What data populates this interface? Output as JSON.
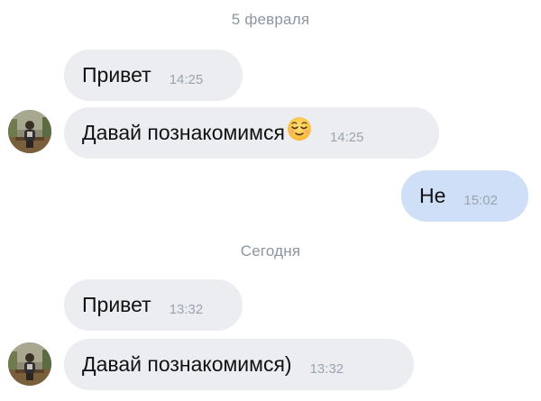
{
  "dates": {
    "first": "5 февраля",
    "second": "Сегодня"
  },
  "messages": [
    {
      "text": "Привет",
      "time": "14:25",
      "direction": "incoming"
    },
    {
      "text": "Давай познакомимся",
      "time": "14:25",
      "direction": "incoming",
      "emoji": "relieved-face-emoji"
    },
    {
      "text": "Не",
      "time": "15:02",
      "direction": "outgoing"
    },
    {
      "text": "Привет",
      "time": "13:32",
      "direction": "incoming"
    },
    {
      "text": "Давай познакомимся)",
      "time": "13:32",
      "direction": "incoming"
    }
  ],
  "colors": {
    "incoming_bubble": "#ebedf0",
    "outgoing_bubble": "#cfdff7",
    "timestamp": "#9aa4ae",
    "date_separator": "#8c96a0"
  }
}
